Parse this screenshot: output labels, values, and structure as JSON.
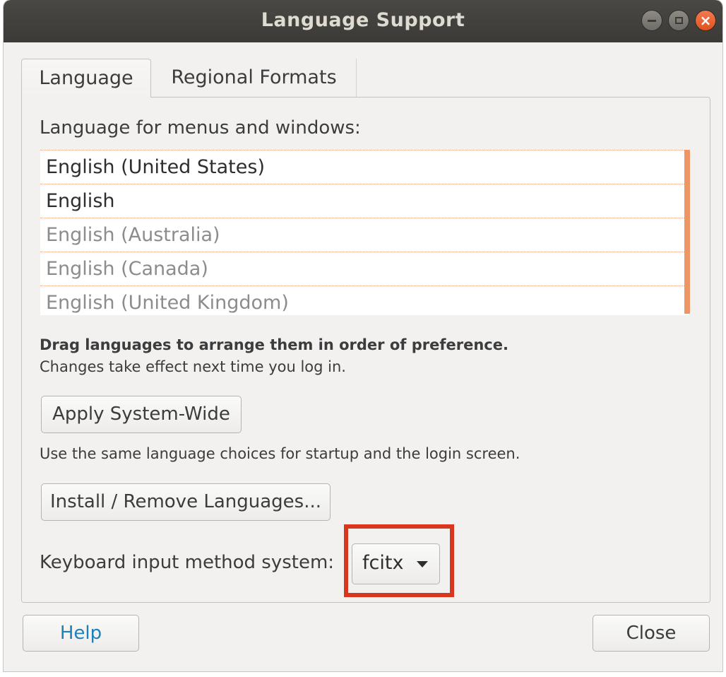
{
  "window": {
    "title": "Language Support"
  },
  "tabs": [
    {
      "label": "Language",
      "active": true
    },
    {
      "label": "Regional Formats",
      "active": false
    }
  ],
  "language_tab": {
    "section_label": "Language for menus and windows:",
    "languages": [
      {
        "label": "English (United States)",
        "enabled": true
      },
      {
        "label": "English",
        "enabled": true
      },
      {
        "label": "English (Australia)",
        "enabled": false
      },
      {
        "label": "English (Canada)",
        "enabled": false
      },
      {
        "label": "English (United Kingdom)",
        "enabled": false
      }
    ],
    "hint_bold": "Drag languages to arrange them in order of preference.",
    "hint": "Changes take effect next time you log in.",
    "apply_button": "Apply System-Wide",
    "apply_description": "Use the same language choices for startup and the login screen.",
    "install_button": "Install / Remove Languages...",
    "keyboard_label": "Keyboard input method system:",
    "keyboard_value": "fcitx"
  },
  "footer": {
    "help_button": "Help",
    "close_button": "Close"
  },
  "colors": {
    "highlight_border": "#d9361f",
    "close_button": "#e0531f",
    "help_text": "#1f7fb8",
    "list_accent": "#ee9565"
  }
}
